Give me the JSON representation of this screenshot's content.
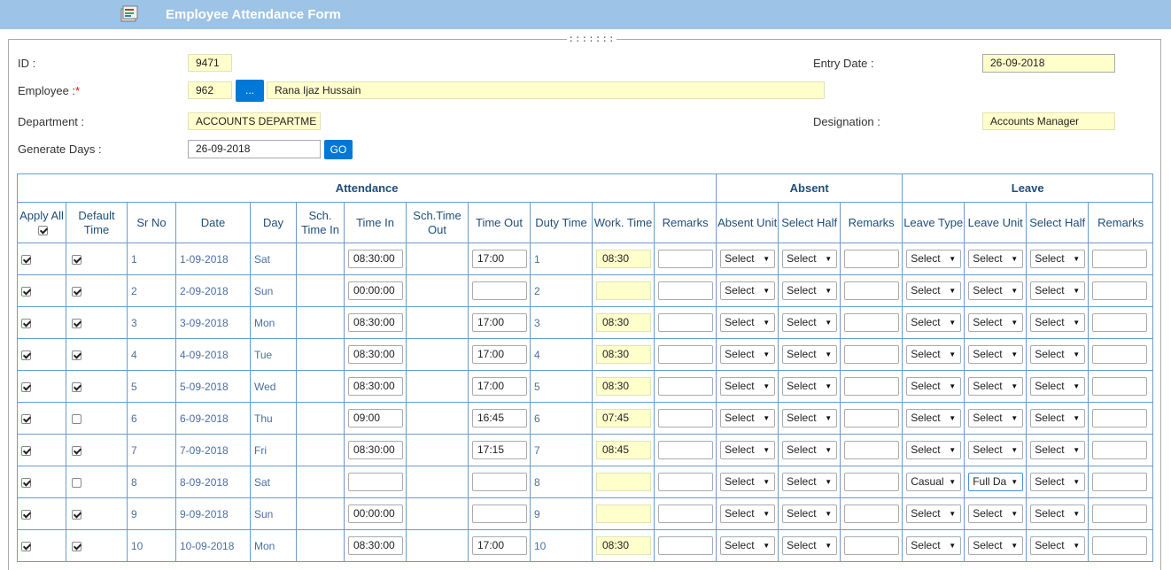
{
  "window": {
    "title": "Employee Attendance Form"
  },
  "form": {
    "id_label": "ID :",
    "id_value": "9471",
    "entry_date_label": "Entry Date :",
    "entry_date_value": "26-09-2018",
    "employee_label": "Employee :",
    "employee_required": "*",
    "employee_code": "962",
    "employee_lookup": "...",
    "employee_name": "Rana Ijaz Hussain",
    "department_label": "Department :",
    "department_value": "ACCOUNTS DEPARTME",
    "designation_label": "Designation :",
    "designation_value": "Accounts Manager",
    "generate_days_label": "Generate Days :",
    "generate_days_value": "26-09-2018",
    "go_label": "GO"
  },
  "grid": {
    "groups": {
      "attendance": "Attendance",
      "absent": "Absent",
      "leave": "Leave"
    },
    "columns": [
      "Apply All",
      "Default Time",
      "Sr No",
      "Date",
      "Day",
      "Sch. Time In",
      "Time In",
      "Sch.Time Out",
      "Time Out",
      "Duty Time",
      "Work. Time",
      "Remarks",
      "Absent Unit",
      "Select Half",
      "Remarks",
      "Leave Type",
      "Leave Unit",
      "Select Half",
      "Remarks"
    ],
    "rows": [
      {
        "apply": true,
        "default": true,
        "sr": "1",
        "date": "1-09-2018",
        "day": "Sat",
        "time_in": "08:30:00",
        "time_out": "17:00",
        "duty": "1",
        "work": "08:30",
        "absent_unit": "Select",
        "absent_half": "Select",
        "leave_type": "Select",
        "leave_unit": "Select",
        "leave_half": "Select"
      },
      {
        "apply": true,
        "default": true,
        "sr": "2",
        "date": "2-09-2018",
        "day": "Sun",
        "time_in": "00:00:00",
        "time_out": "",
        "duty": "2",
        "work": "",
        "absent_unit": "Select",
        "absent_half": "Select",
        "leave_type": "Select",
        "leave_unit": "Select",
        "leave_half": "Select"
      },
      {
        "apply": true,
        "default": true,
        "sr": "3",
        "date": "3-09-2018",
        "day": "Mon",
        "time_in": "08:30:00",
        "time_out": "17:00",
        "duty": "3",
        "work": "08:30",
        "absent_unit": "Select",
        "absent_half": "Select",
        "leave_type": "Select",
        "leave_unit": "Select",
        "leave_half": "Select"
      },
      {
        "apply": true,
        "default": true,
        "sr": "4",
        "date": "4-09-2018",
        "day": "Tue",
        "time_in": "08:30:00",
        "time_out": "17:00",
        "duty": "4",
        "work": "08:30",
        "absent_unit": "Select",
        "absent_half": "Select",
        "leave_type": "Select",
        "leave_unit": "Select",
        "leave_half": "Select"
      },
      {
        "apply": true,
        "default": true,
        "sr": "5",
        "date": "5-09-2018",
        "day": "Wed",
        "time_in": "08:30:00",
        "time_out": "17:00",
        "duty": "5",
        "work": "08:30",
        "absent_unit": "Select",
        "absent_half": "Select",
        "leave_type": "Select",
        "leave_unit": "Select",
        "leave_half": "Select"
      },
      {
        "apply": true,
        "default": false,
        "sr": "6",
        "date": "6-09-2018",
        "day": "Thu",
        "time_in": "09:00",
        "time_out": "16:45",
        "duty": "6",
        "work": "07:45",
        "absent_unit": "Select",
        "absent_half": "Select",
        "leave_type": "Select",
        "leave_unit": "Select",
        "leave_half": "Select"
      },
      {
        "apply": true,
        "default": true,
        "sr": "7",
        "date": "7-09-2018",
        "day": "Fri",
        "time_in": "08:30:00",
        "time_out": "17:15",
        "duty": "7",
        "work": "08:45",
        "absent_unit": "Select",
        "absent_half": "Select",
        "leave_type": "Select",
        "leave_unit": "Select",
        "leave_half": "Select"
      },
      {
        "apply": true,
        "default": false,
        "sr": "8",
        "date": "8-09-2018",
        "day": "Sat",
        "time_in": "",
        "time_out": "",
        "duty": "8",
        "work": "",
        "absent_unit": "Select",
        "absent_half": "Select",
        "leave_type": "Casual",
        "leave_unit": "Full Da",
        "leave_half": "Select"
      },
      {
        "apply": true,
        "default": true,
        "sr": "9",
        "date": "9-09-2018",
        "day": "Sun",
        "time_in": "00:00:00",
        "time_out": "",
        "duty": "9",
        "work": "",
        "absent_unit": "Select",
        "absent_half": "Select",
        "leave_type": "Select",
        "leave_unit": "Select",
        "leave_half": "Select"
      },
      {
        "apply": true,
        "default": true,
        "sr": "10",
        "date": "10-09-2018",
        "day": "Mon",
        "time_in": "08:30:00",
        "time_out": "17:00",
        "duty": "10",
        "work": "08:30",
        "absent_unit": "Select",
        "absent_half": "Select",
        "leave_type": "Select",
        "leave_unit": "Select",
        "leave_half": "Select"
      }
    ]
  }
}
